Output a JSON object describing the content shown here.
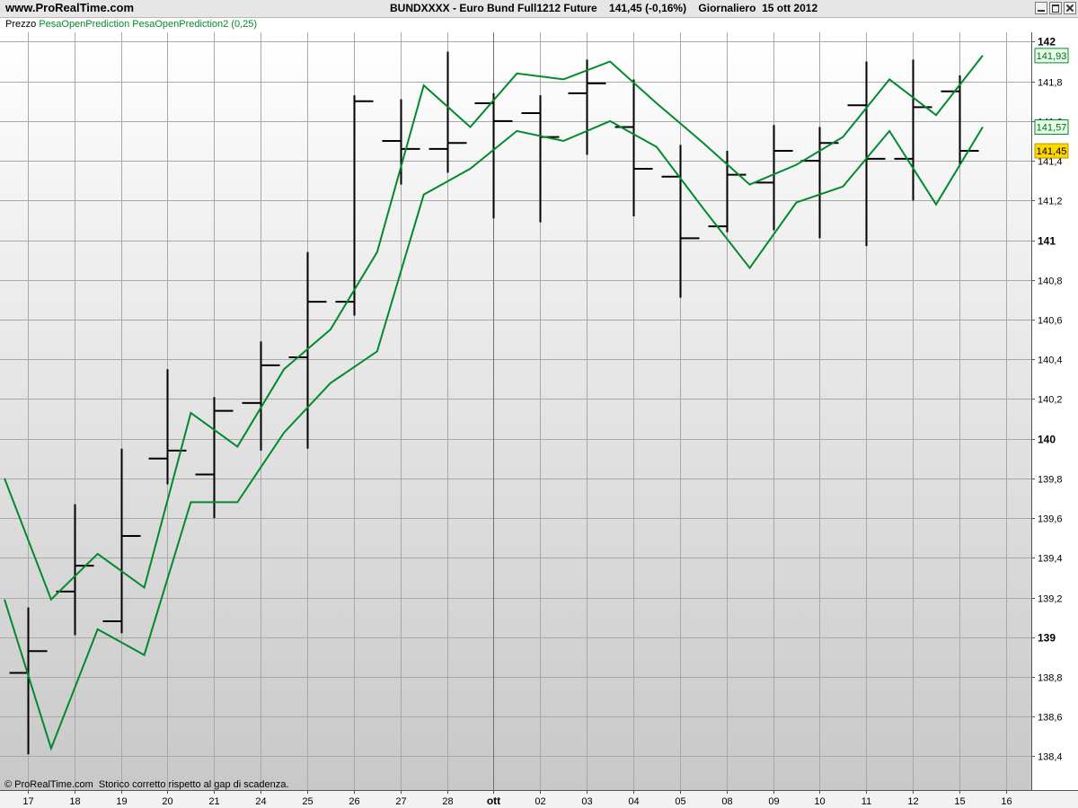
{
  "header": {
    "site": "www.ProRealTime.com",
    "title": "BUNDXXXX - Euro Bund Full1212 Future    141,45 (-0,16%)    Giornaliero  15 ott 2012"
  },
  "legend": {
    "price_label": "Prezzo",
    "indicators": "PesaOpenPrediction PesaOpenPrediction2 (0,25)"
  },
  "footer": "© ProRealTime.com  Storico corretto rispetto al gap di scadenza.",
  "colors": {
    "price_bars": "#000000",
    "indicator_lines": "#008a2e",
    "last_price_badge": "#ffd700",
    "indicator_badge": "#e8ffe8"
  },
  "chart_data": {
    "type": "ohlc",
    "title": "BUNDXXXX - Euro Bund Full1212 Future",
    "x_tick_labels": [
      "17",
      "18",
      "19",
      "20",
      "21",
      "24",
      "25",
      "26",
      "27",
      "28",
      "ott",
      "02",
      "03",
      "04",
      "05",
      "08",
      "09",
      "10",
      "11",
      "12",
      "15",
      "16"
    ],
    "y_ticks": [
      "138,4",
      "138,6",
      "138,8",
      "139",
      "139,2",
      "139,4",
      "139,6",
      "139,8",
      "140",
      "140,2",
      "140,4",
      "140,6",
      "140,8",
      "141",
      "141,2",
      "141,4",
      "141,6",
      "141,8",
      "142"
    ],
    "ylim": [
      138.3,
      142.1
    ],
    "grid": true,
    "bars": [
      {
        "date": "17",
        "open": 138.82,
        "high": 139.15,
        "low": 138.41,
        "close": 138.93
      },
      {
        "date": "18",
        "open": 139.23,
        "high": 139.67,
        "low": 139.01,
        "close": 139.36
      },
      {
        "date": "19",
        "open": 139.08,
        "high": 139.95,
        "low": 139.02,
        "close": 139.51
      },
      {
        "date": "20",
        "open": 139.9,
        "high": 140.35,
        "low": 139.77,
        "close": 139.94
      },
      {
        "date": "21",
        "open": 139.82,
        "high": 140.21,
        "low": 139.6,
        "close": 140.14
      },
      {
        "date": "24",
        "open": 140.18,
        "high": 140.49,
        "low": 139.94,
        "close": 140.37
      },
      {
        "date": "25",
        "open": 140.41,
        "high": 140.94,
        "low": 139.95,
        "close": 140.69
      },
      {
        "date": "26",
        "open": 140.69,
        "high": 141.73,
        "low": 140.62,
        "close": 141.7
      },
      {
        "date": "27",
        "open": 141.5,
        "high": 141.71,
        "low": 141.28,
        "close": 141.46
      },
      {
        "date": "28",
        "open": 141.46,
        "high": 141.95,
        "low": 141.34,
        "close": 141.49
      },
      {
        "date": "ott",
        "open": 141.69,
        "high": 141.74,
        "low": 141.11,
        "close": 141.6
      },
      {
        "date": "02",
        "open": 141.64,
        "high": 141.73,
        "low": 141.09,
        "close": 141.52
      },
      {
        "date": "03",
        "open": 141.74,
        "high": 141.91,
        "low": 141.43,
        "close": 141.79
      },
      {
        "date": "04",
        "open": 141.57,
        "high": 141.81,
        "low": 141.12,
        "close": 141.36
      },
      {
        "date": "05",
        "open": 141.32,
        "high": 141.48,
        "low": 140.71,
        "close": 141.01
      },
      {
        "date": "08",
        "open": 141.07,
        "high": 141.45,
        "low": 141.04,
        "close": 141.33
      },
      {
        "date": "09",
        "open": 141.29,
        "high": 141.58,
        "low": 141.05,
        "close": 141.45
      },
      {
        "date": "10",
        "open": 141.4,
        "high": 141.57,
        "low": 141.01,
        "close": 141.49
      },
      {
        "date": "11",
        "open": 141.68,
        "high": 141.9,
        "low": 140.97,
        "close": 141.41
      },
      {
        "date": "12",
        "open": 141.41,
        "high": 141.91,
        "low": 141.2,
        "close": 141.67
      },
      {
        "date": "15",
        "open": 141.75,
        "high": 141.83,
        "low": 141.38,
        "close": 141.45
      }
    ],
    "series": [
      {
        "name": "PesaOpenPrediction",
        "values": [
          139.8,
          139.19,
          139.42,
          139.25,
          140.13,
          139.96,
          140.35,
          140.55,
          140.94,
          141.78,
          141.57,
          141.84,
          141.81,
          141.9,
          141.69,
          141.49,
          141.28,
          141.38,
          141.52,
          141.81,
          141.63,
          141.93
        ]
      },
      {
        "name": "PesaOpenPrediction2",
        "values": [
          139.19,
          138.44,
          139.04,
          138.91,
          139.68,
          139.68,
          140.03,
          140.28,
          140.44,
          141.23,
          141.36,
          141.55,
          141.5,
          141.6,
          141.47,
          141.16,
          140.86,
          141.19,
          141.27,
          141.55,
          141.18,
          141.57
        ]
      },
      {
        "name": "Prezzo",
        "values": [
          141.45
        ]
      }
    ],
    "price_badges": [
      {
        "label": "141,93",
        "kind": "indicator"
      },
      {
        "label": "141,57",
        "kind": "indicator"
      },
      {
        "label": "141,45",
        "kind": "last"
      }
    ]
  }
}
